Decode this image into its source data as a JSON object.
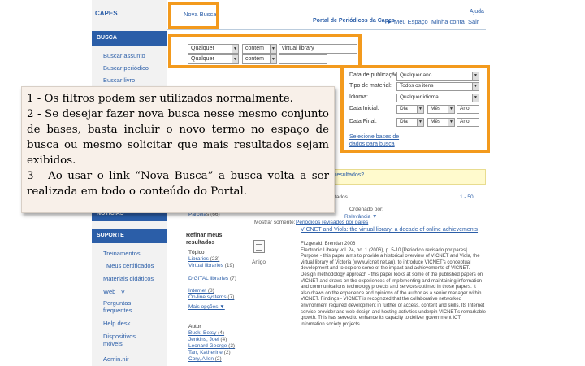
{
  "sidebar": {
    "logo": "CAPES",
    "busca_header": "BUSCA",
    "busca_items": [
      "Buscar assunto",
      "Buscar periódico",
      "Buscar livro"
    ],
    "noticias_header": "NOTÍCIAS",
    "suporte_header": "SUPORTE",
    "suporte_items": [
      "Treinamentos",
      "Meus certificados",
      "Materiais didáticos",
      "Web TV",
      "Perguntas frequentes",
      "Help desk",
      "Dispositivos móveis",
      "Admin.nir"
    ]
  },
  "header": {
    "nova_busca_tab": "Nova Busca",
    "ajuda": "Ajuda",
    "portal_title": "Portal de Periódicos da Capes",
    "meu_espaco": "Meu Espaço",
    "minha_conta": "Minha conta",
    "sair": "Sair"
  },
  "search": {
    "row1": {
      "field": "Qualquer",
      "op": "contém",
      "value": "virtual library"
    },
    "row2": {
      "field": "Qualquer",
      "op": "contém",
      "value": ""
    }
  },
  "filters": {
    "data_publicacao_label": "Data de publicação:",
    "data_publicacao_value": "Qualquer ano",
    "tipo_material_label": "Tipo de material:",
    "tipo_material_value": "Todos os itens",
    "idioma_label": "Idioma:",
    "idioma_value": "Qualquer idioma",
    "data_inicial_label": "Data Inicial:",
    "data_final_label": "Data Final:",
    "dia": "Dia",
    "mes": "Mês",
    "ano": "Ano",
    "link_line1": "Selecione bases de",
    "link_line2": "dados para busca"
  },
  "results": {
    "yellow_link": "resultados?",
    "pagination": "1 - 50",
    "ordenado_por": "Ordenado por:",
    "relevancia": "Relevância",
    "mostrar_somente": "Mostrar somente:",
    "revisados": "Periódicos revisados por pares",
    "artigo_label": "Artigo",
    "refine_header": "Refinar meus resultados",
    "topics_header": "Tópico",
    "topics": [
      {
        "label": "Libraries",
        "count": "(23)"
      },
      {
        "label": "Virtual libraries",
        "count": "(19)"
      },
      {
        "label": "DIGITAL libraries",
        "count": "(7)"
      },
      {
        "label": "Internet",
        "count": "(8)"
      },
      {
        "label": "On-line systems",
        "count": "(7)"
      }
    ],
    "more": "Mais opções",
    "autor_header": "Autor",
    "authors": [
      {
        "label": "Buck, Betsy",
        "count": "(4)"
      },
      {
        "label": "Jenkins, Joel",
        "count": "(4)"
      },
      {
        "label": "Leonard George",
        "count": "(3)"
      },
      {
        "label": "Tan, Katherine",
        "count": "(2)"
      },
      {
        "label": "Cory, Allen",
        "count": "(2)"
      }
    ],
    "record_title": "VICNET and Viola: the virtual library: a decade of online achievements",
    "record_author": "Fitzgerald, Brendan 2006",
    "record_source": "Electronic Library vol. 24, no. 1 (2006), p. 5-10 [Periódico revisado por pares]",
    "record_abstract": "Purpose - this paper aims to provide a historical overview of VICNET and Viola, the virtual library of Victoria (www.vicnet.net.au), to introduce VICNET's conceptual development and to explore some of the impact and achievements of VICNET. Design methodology approach - this paper looks at some of the published papers on VICNET and draws on the experiences of implementing and maintaining information and communications technology projects and services outlined in those papers. It also draws on the experience and opinions of the author as a senior manager within VICNET. Findings - VICNET is recognized that the collaborative networked environment required development in further of access, content and skills. Its Internet service provider and web design and hosting activities underpin VICNET's remarkable growth. This has served to enhance its capacity to deliver government ICT information society projects"
  },
  "note": {
    "line1": "1 - Os filtros podem ser utilizados normalmente.",
    "line2": "2 - Se desejar fazer nova busca nesse mesmo conjunto de bases, basta incluir o novo termo no espaço de busca ou mesmo solicitar que mais resultados sejam exibidos.",
    "line3": "3 - Ao usar o link “Nova Busca” a busca volta a ser realizada em todo o conteúdo do Portal."
  },
  "colors": {
    "highlight": "#f39a1d",
    "link": "#2b5ea8",
    "note_bg": "#f8f0e9"
  }
}
